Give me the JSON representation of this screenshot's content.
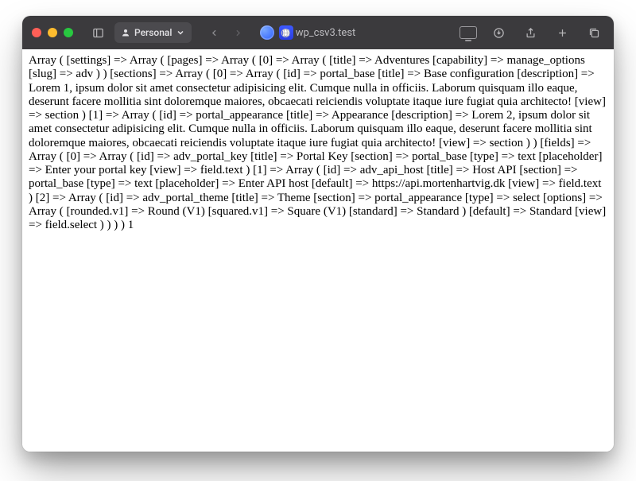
{
  "window": {
    "personal_label": "Personal",
    "address": "wp_csv3.test"
  },
  "dump_text": "Array ( [settings] => Array ( [pages] => Array ( [0] => Array ( [title] => Adventures [capability] => manage_options [slug] => adv ) ) [sections] => Array ( [0] => Array ( [id] => portal_base [title] => Base configuration [description] => Lorem 1, ipsum dolor sit amet consectetur adipisicing elit. Cumque nulla in officiis. Laborum quisquam illo eaque, deserunt facere mollitia sint doloremque maiores, obcaecati reiciendis voluptate itaque iure fugiat quia architecto! [view] => section ) [1] => Array ( [id] => portal_appearance [title] => Appearance [description] => Lorem 2, ipsum dolor sit amet consectetur adipisicing elit. Cumque nulla in officiis. Laborum quisquam illo eaque, deserunt facere mollitia sint doloremque maiores, obcaecati reiciendis voluptate itaque iure fugiat quia architecto! [view] => section ) ) [fields] => Array ( [0] => Array ( [id] => adv_portal_key [title] => Portal Key [section] => portal_base [type] => text [placeholder] => Enter your portal key [view] => field.text ) [1] => Array ( [id] => adv_api_host [title] => Host API [section] => portal_base [type] => text [placeholder] => Enter API host [default] => https://api.mortenhartvig.dk [view] => field.text ) [2] => Array ( [id] => adv_portal_theme [title] => Theme [section] => portal_appearance [type] => select [options] => Array ( [rounded.v1] => Round (V1) [squared.v1] => Square (V1) [standard] => Standard ) [default] => Standard [view] => field.select ) ) ) ) 1"
}
